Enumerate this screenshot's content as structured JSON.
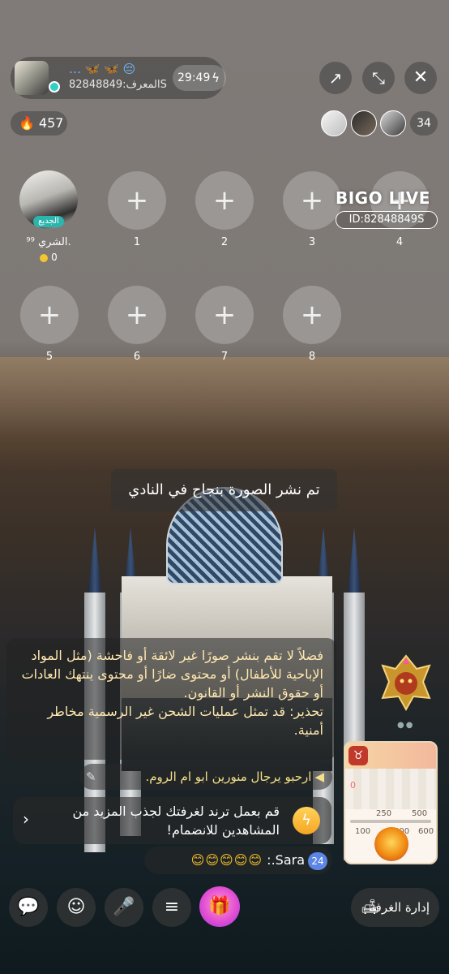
{
  "host": {
    "name": "… 🦋 🦋 😔",
    "id_label": "المعرف:82848849S",
    "timer": "29:49"
  },
  "top_actions": {
    "share_icon": "share-icon",
    "minimize_icon": "minimize-icon",
    "close_icon": "close-icon"
  },
  "stats": {
    "heat": "457",
    "viewer_count": "34"
  },
  "watermark": {
    "brand": "BIGO LIVE",
    "id": "ID:82848849S"
  },
  "host_seat": {
    "tag": "الجديع",
    "name": "الشري ⁹⁹.",
    "coins": "0"
  },
  "seats": [
    {
      "label": "1"
    },
    {
      "label": "2"
    },
    {
      "label": "3"
    },
    {
      "label": "4"
    },
    {
      "label": "5"
    },
    {
      "label": "6"
    },
    {
      "label": "7"
    },
    {
      "label": "8"
    }
  ],
  "toast": "تم نشر الصورة بنجاح في النادي",
  "notice": {
    "line1": "فضلاً لا تقم بنشر صورًا غير لائقة أو فاحشة (مثل المواد الإباحية للأطفال) أو محتوى ضارًا أو محتوى ينتهك العادات أو حقوق النشر أو القانون.",
    "line2": "تحذير: قد تمثل عمليات الشحن غير الرسمية مخاطر أمنية."
  },
  "welcome": "ارحبو يرجال منورين ابو ام الروم.",
  "trend": "قم بعمل ترند لغرفتك لجذب المزيد من المشاهدين للانضمام!",
  "chat": {
    "level": "24",
    "user": "Sara.:",
    "emojis": "😊😊😊😊😊"
  },
  "gift_card": {
    "heart_value": "0",
    "tick_250": "250",
    "tick_500": "500",
    "tick_100": "100",
    "tick_400": "400",
    "tick_600": "600"
  },
  "bottom_bar": {
    "room_manage": "إدارة الغرفة"
  }
}
